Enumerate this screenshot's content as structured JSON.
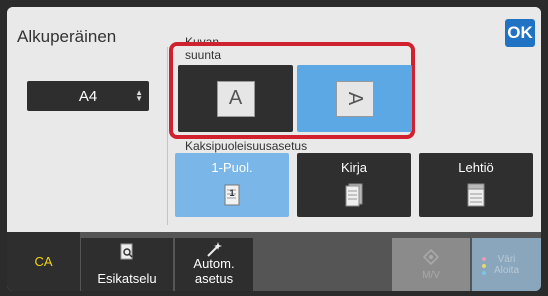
{
  "header": {
    "title": "Alkuperäinen",
    "ok_label": "OK"
  },
  "original_size": {
    "value": "A4",
    "arrows_icon": "updown-arrows-icon"
  },
  "orientation": {
    "label": "Kuvan\nsuunta",
    "label_line1": "Kuvan",
    "label_line2": "suunta",
    "options": [
      {
        "glyph": "A",
        "selected": false,
        "icon": "portrait-page-icon"
      },
      {
        "glyph": "A",
        "selected": true,
        "icon": "landscape-page-icon"
      }
    ]
  },
  "duplex": {
    "label": "Kaksipuoleisuusasetus",
    "options": [
      {
        "label": "1-Puol.",
        "selected": true,
        "icon": "one-sided-doc-icon",
        "badge": "1"
      },
      {
        "label": "Kirja",
        "selected": false,
        "icon": "book-doc-icon"
      },
      {
        "label": "Lehtiö",
        "selected": false,
        "icon": "tablet-doc-icon"
      }
    ]
  },
  "bottom_bar": {
    "ca_label": "CA",
    "preview_label": "Esikatselu",
    "auto_label_line1": "Autom.",
    "auto_label_line2": "asetus",
    "start_bw_label": "M/V",
    "start_color_label_line1": "Väri",
    "start_color_label_line2": "Aloita"
  },
  "colors": {
    "accent_blue": "#1f73c2",
    "selected_blue": "#5ca8e5",
    "highlight_red": "#d0212e",
    "ca_yellow": "#f5d21a"
  }
}
